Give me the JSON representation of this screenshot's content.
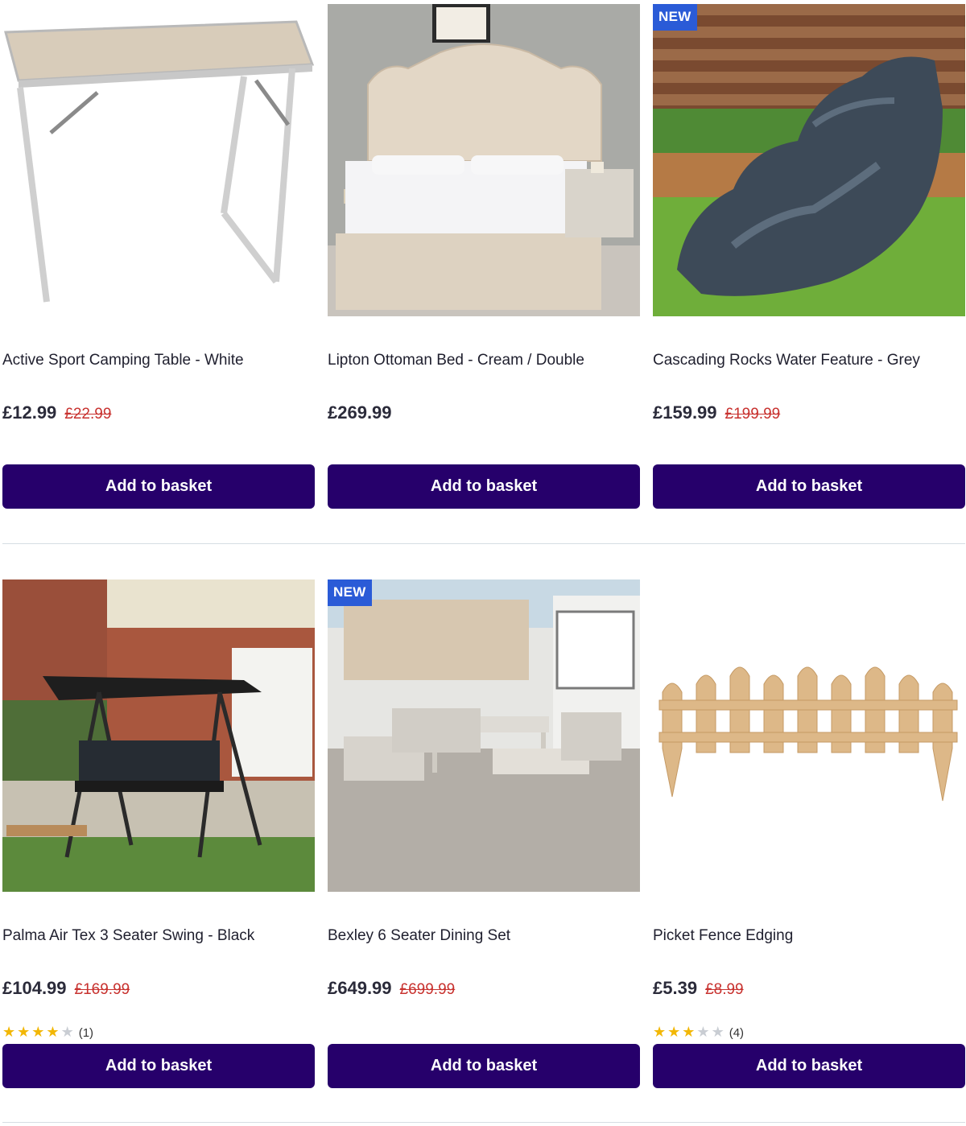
{
  "products": [
    {
      "title": "Active Sport Camping Table - White",
      "price": "£12.99",
      "was_price": "£22.99",
      "badge": "",
      "button": "Add to basket",
      "image_icon": "camping-table-image"
    },
    {
      "title": "Lipton Ottoman Bed - Cream / Double",
      "price": "£269.99",
      "was_price": "",
      "badge": "",
      "button": "Add to basket",
      "image_icon": "ottoman-bed-image"
    },
    {
      "title": "Cascading Rocks Water Feature - Grey",
      "price": "£159.99",
      "was_price": "£199.99",
      "badge": "NEW",
      "button": "Add to basket",
      "image_icon": "water-feature-image"
    },
    {
      "title": "Palma Air Tex 3 Seater Swing - Black",
      "price": "£104.99",
      "was_price": "£169.99",
      "badge": "",
      "rating_stars": 4,
      "rating_count": "(1)",
      "button": "Add to basket",
      "image_icon": "garden-swing-image"
    },
    {
      "title": "Bexley 6 Seater Dining Set",
      "price": "£649.99",
      "was_price": "£699.99",
      "badge": "NEW",
      "button": "Add to basket",
      "image_icon": "dining-set-image"
    },
    {
      "title": "Picket Fence Edging",
      "price": "£5.39",
      "was_price": "£8.99",
      "badge": "",
      "rating_stars": 3,
      "rating_count": "(4)",
      "button": "Add to basket",
      "image_icon": "picket-fence-image"
    }
  ],
  "colors": {
    "button_bg": "#26006b",
    "badge_bg": "#2a5bd7",
    "was_price": "#c8322f",
    "star_on": "#f2b705",
    "star_off": "#c9cdd3"
  }
}
